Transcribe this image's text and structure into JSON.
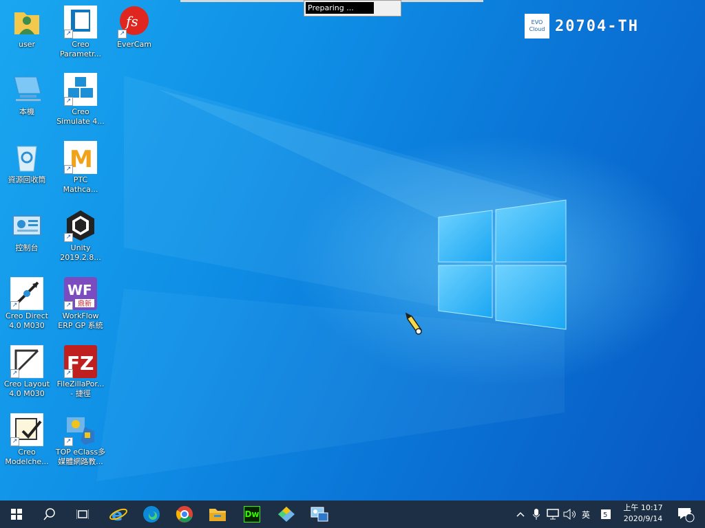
{
  "top_dialog": {
    "status": "Preparing ..."
  },
  "badge": {
    "logo_line1": "EVO",
    "logo_line2": "Cloud",
    "hostname": "20704-TH"
  },
  "desktop_icons": [
    {
      "label": "user",
      "icon": "user-folder-icon"
    },
    {
      "label": "Creo Parametr...",
      "icon": "creo-parametric-icon"
    },
    {
      "label": "EverCam",
      "icon": "evercam-icon"
    },
    {
      "label": "本機",
      "icon": "this-pc-icon"
    },
    {
      "label": "Creo Simulate 4...",
      "icon": "creo-simulate-icon"
    },
    {
      "label": "資源回收筒",
      "icon": "recycle-bin-icon"
    },
    {
      "label": "PTC Mathca...",
      "icon": "ptc-mathcad-icon"
    },
    {
      "label": "控制台",
      "icon": "control-panel-icon"
    },
    {
      "label": "Unity 2019.2.8...",
      "icon": "unity-icon"
    },
    {
      "label": "Creo Direct 4.0 M030",
      "icon": "creo-direct-icon"
    },
    {
      "label": "WorkFlow ERP GP 系統",
      "icon": "workflow-erp-icon",
      "badge_text": "WF",
      "badge_sub": "鼎新"
    },
    {
      "label": "Creo Layout 4.0 M030",
      "icon": "creo-layout-icon"
    },
    {
      "label": "FileZillaPor... - 捷徑",
      "icon": "filezilla-icon",
      "badge_text": "FZ"
    },
    {
      "label": "Creo Modelche...",
      "icon": "creo-modelcheck-icon"
    },
    {
      "label": "TOP eClass多媒體網路教...",
      "icon": "top-eclass-icon"
    }
  ],
  "taskbar": {
    "pinned": [
      {
        "icon": "internet-explorer-icon"
      },
      {
        "icon": "edge-icon"
      },
      {
        "icon": "chrome-icon"
      },
      {
        "icon": "file-explorer-icon"
      },
      {
        "icon": "dreamweaver-icon",
        "text": "Dw"
      },
      {
        "icon": "app-diamond-icon"
      },
      {
        "icon": "app-network-icon"
      }
    ],
    "ime": "英",
    "clock_time": "上午 10:17",
    "clock_date": "2020/9/14",
    "notification_count": "2"
  }
}
